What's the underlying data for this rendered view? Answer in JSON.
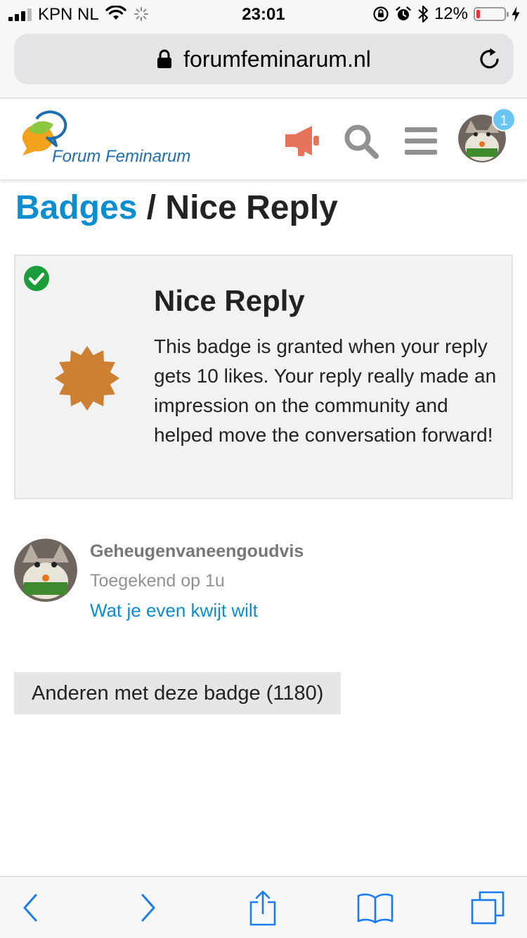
{
  "status_bar": {
    "carrier": "KPN NL",
    "time": "23:01",
    "battery_percent": "12%",
    "battery_level": 0.12
  },
  "browser": {
    "url": "forumfeminarum.nl"
  },
  "site": {
    "logo_text": "Forum Feminarum",
    "notification_count": "1"
  },
  "breadcrumb": {
    "parent": "Badges",
    "separator": " / ",
    "current": "Nice Reply"
  },
  "badge": {
    "name": "Nice Reply",
    "description": "This badge is granted when your reply gets 10 likes. Your reply really made an impression on the community and helped move the conversation forward!",
    "color": "#cd7f32"
  },
  "grant": {
    "username": "Geheugenvaneengoudvis",
    "granted_text": "Toegekend op 1u",
    "topic_link": "Wat je even kwijt wilt"
  },
  "others_button": {
    "label": "Anderen met deze badge (1180)"
  },
  "colors": {
    "link": "#0a8ed0",
    "accent_megaphone": "#e8735c",
    "check_green": "#1a9c3a",
    "ios_blue": "#1a7cf5"
  }
}
